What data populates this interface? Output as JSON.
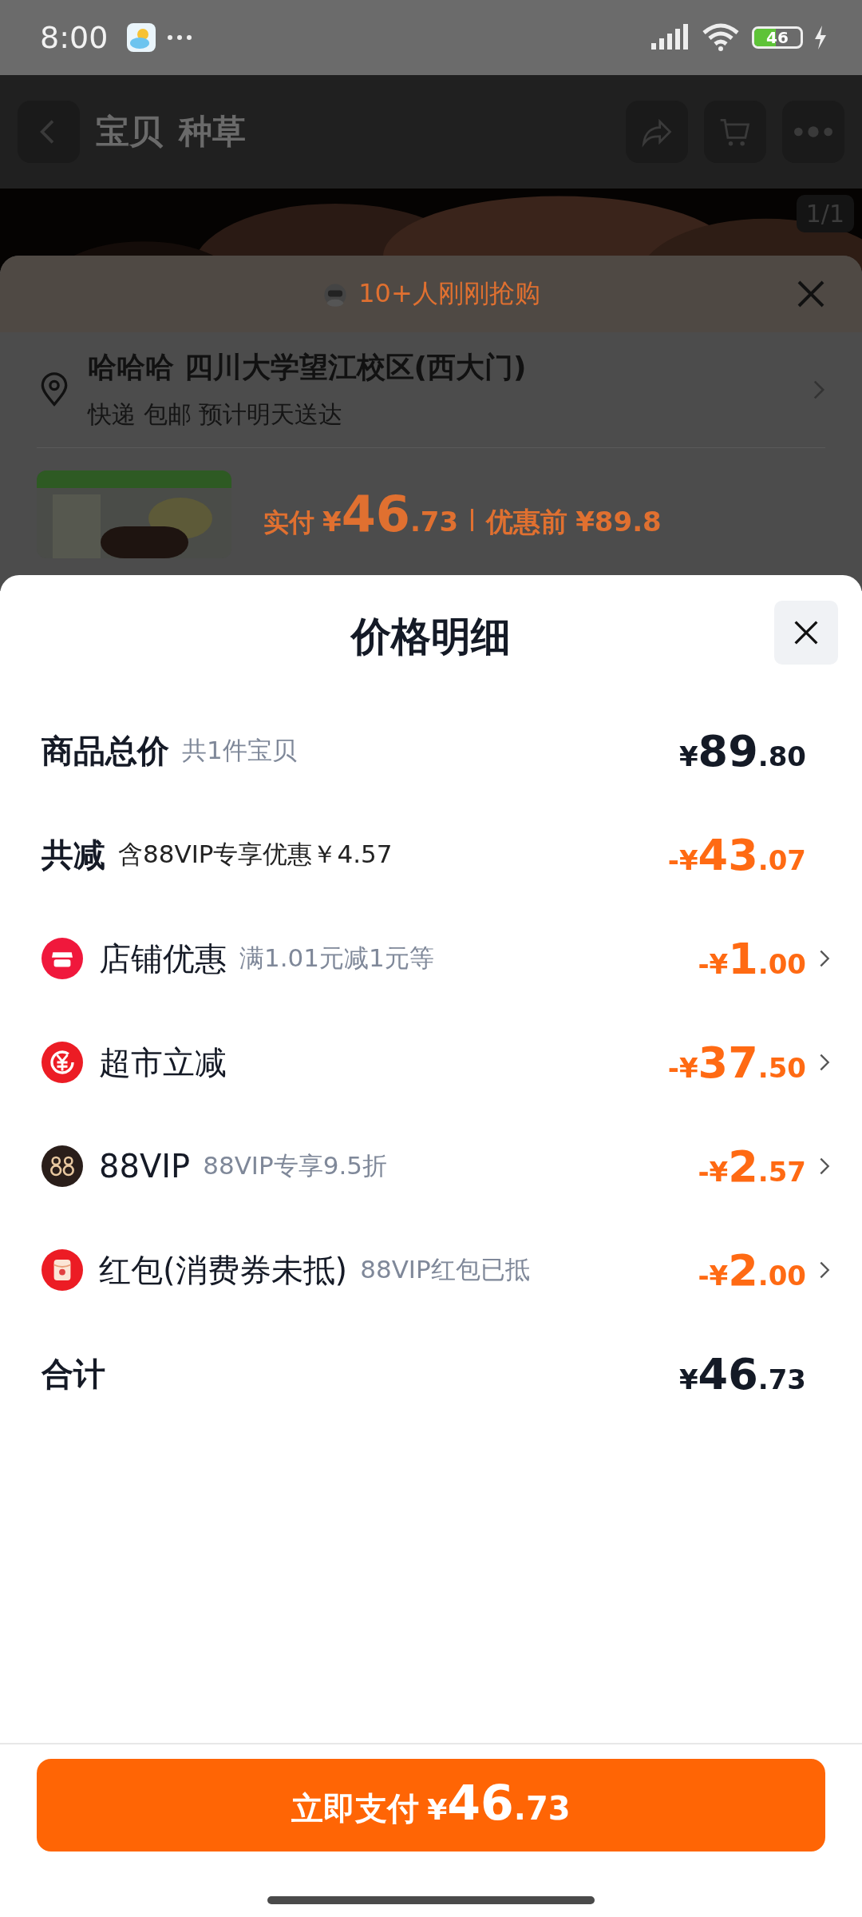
{
  "status_bar": {
    "time": "8:00",
    "battery": "46"
  },
  "nav": {
    "tabs": [
      {
        "label": "宝贝",
        "selected": false
      },
      {
        "label": "种草",
        "selected": false
      }
    ]
  },
  "gallery": {
    "counter": "1/1"
  },
  "order_sheet": {
    "banner": "10+人刚刚抢购",
    "address": "哈哈哈 四川大学望江校区(西大门)",
    "delivery": "快递 包邮 预计明天送达",
    "paid_label": "实付",
    "paid_amount": "¥46.73",
    "before_label": "优惠前",
    "before_amount": "¥89.8"
  },
  "price_detail": {
    "title": "价格明细",
    "rows": [
      {
        "kind": "summary",
        "label": "商品总价",
        "note": "共1件宝贝",
        "amount": "¥89.80"
      },
      {
        "kind": "reduction",
        "label": "共减",
        "note": "含88VIP专享优惠￥4.57",
        "amount": "-¥43.07"
      },
      {
        "kind": "discount",
        "label": "店铺优惠",
        "note": "满1.01元减1元等",
        "amount": "-¥1.00"
      },
      {
        "kind": "discount",
        "label": "超市立减",
        "amount": "-¥37.50"
      },
      {
        "kind": "discount",
        "label": "88VIP",
        "note": "88VIP专享9.5折",
        "amount": "-¥2.57"
      },
      {
        "kind": "discount",
        "label": "红包(消费券未抵)",
        "note": "88VIP红包已抵",
        "amount": "-¥2.00"
      },
      {
        "kind": "summary",
        "label": "合计",
        "amount": "¥46.73"
      }
    ],
    "pay_button": {
      "label": "立即支付",
      "amount": "¥46.73"
    }
  }
}
